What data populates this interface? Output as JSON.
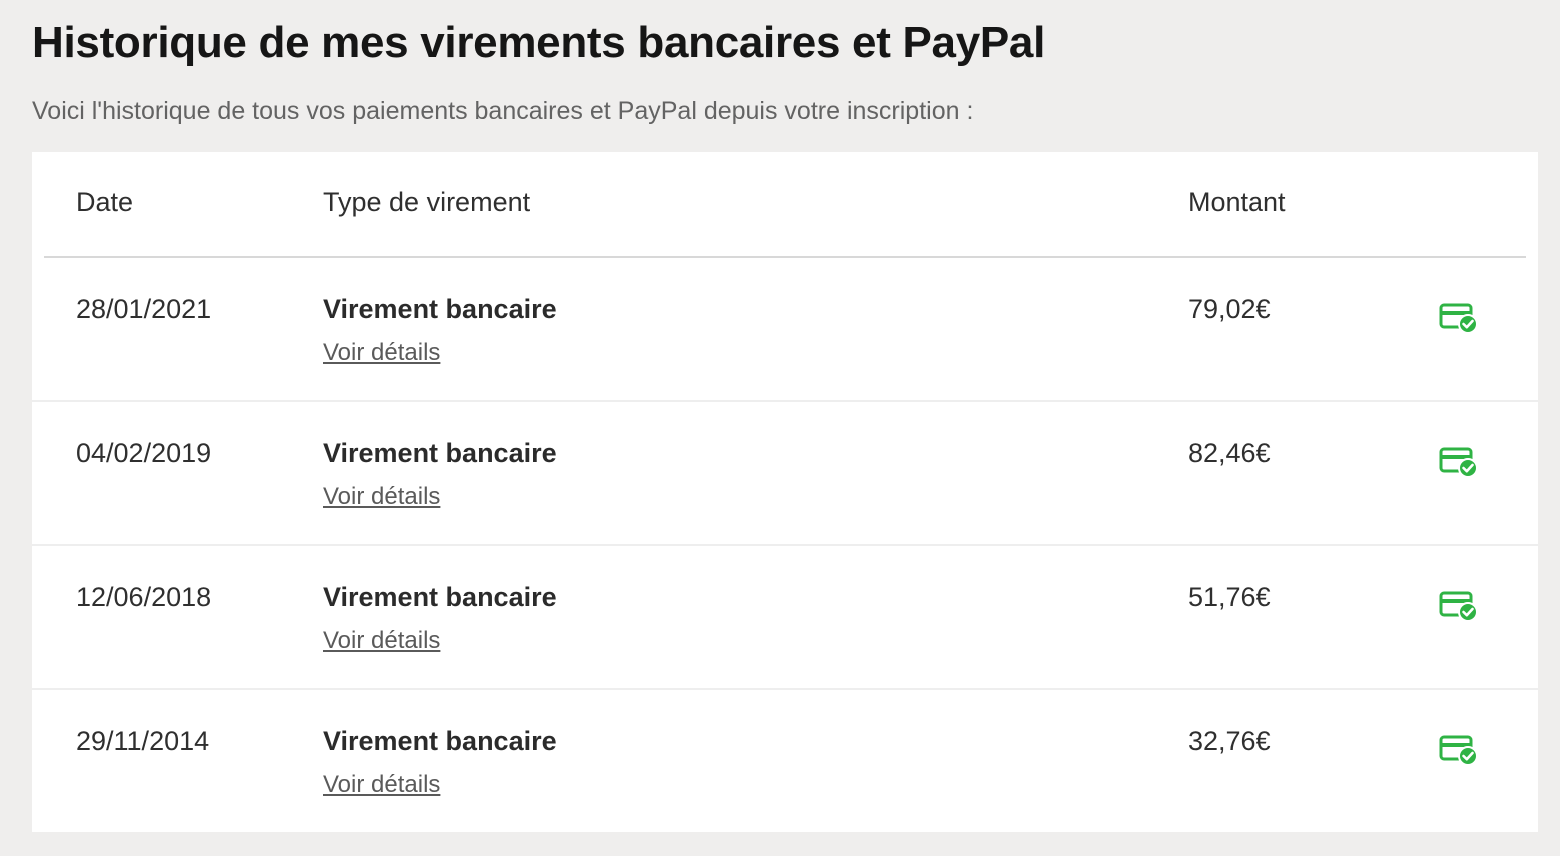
{
  "header": {
    "title": "Historique de mes virements bancaires et PayPal",
    "subtitle": "Voici l'historique de tous vos paiements bancaires et PayPal depuis votre inscription :"
  },
  "table": {
    "columns": {
      "date": "Date",
      "type": "Type de virement",
      "amount": "Montant"
    },
    "rows": [
      {
        "date": "28/01/2021",
        "type": "Virement bancaire",
        "link": "Voir détails",
        "amount": "79,02€",
        "status_icon": "card-check-icon"
      },
      {
        "date": "04/02/2019",
        "type": "Virement bancaire",
        "link": "Voir détails",
        "amount": "82,46€",
        "status_icon": "card-check-icon"
      },
      {
        "date": "12/06/2018",
        "type": "Virement bancaire",
        "link": "Voir détails",
        "amount": "51,76€",
        "status_icon": "card-check-icon"
      },
      {
        "date": "29/11/2014",
        "type": "Virement bancaire",
        "link": "Voir détails",
        "amount": "32,76€",
        "status_icon": "card-check-icon"
      }
    ]
  },
  "colors": {
    "background": "#efeeed",
    "card": "#ffffff",
    "status_green": "#2fb344"
  }
}
